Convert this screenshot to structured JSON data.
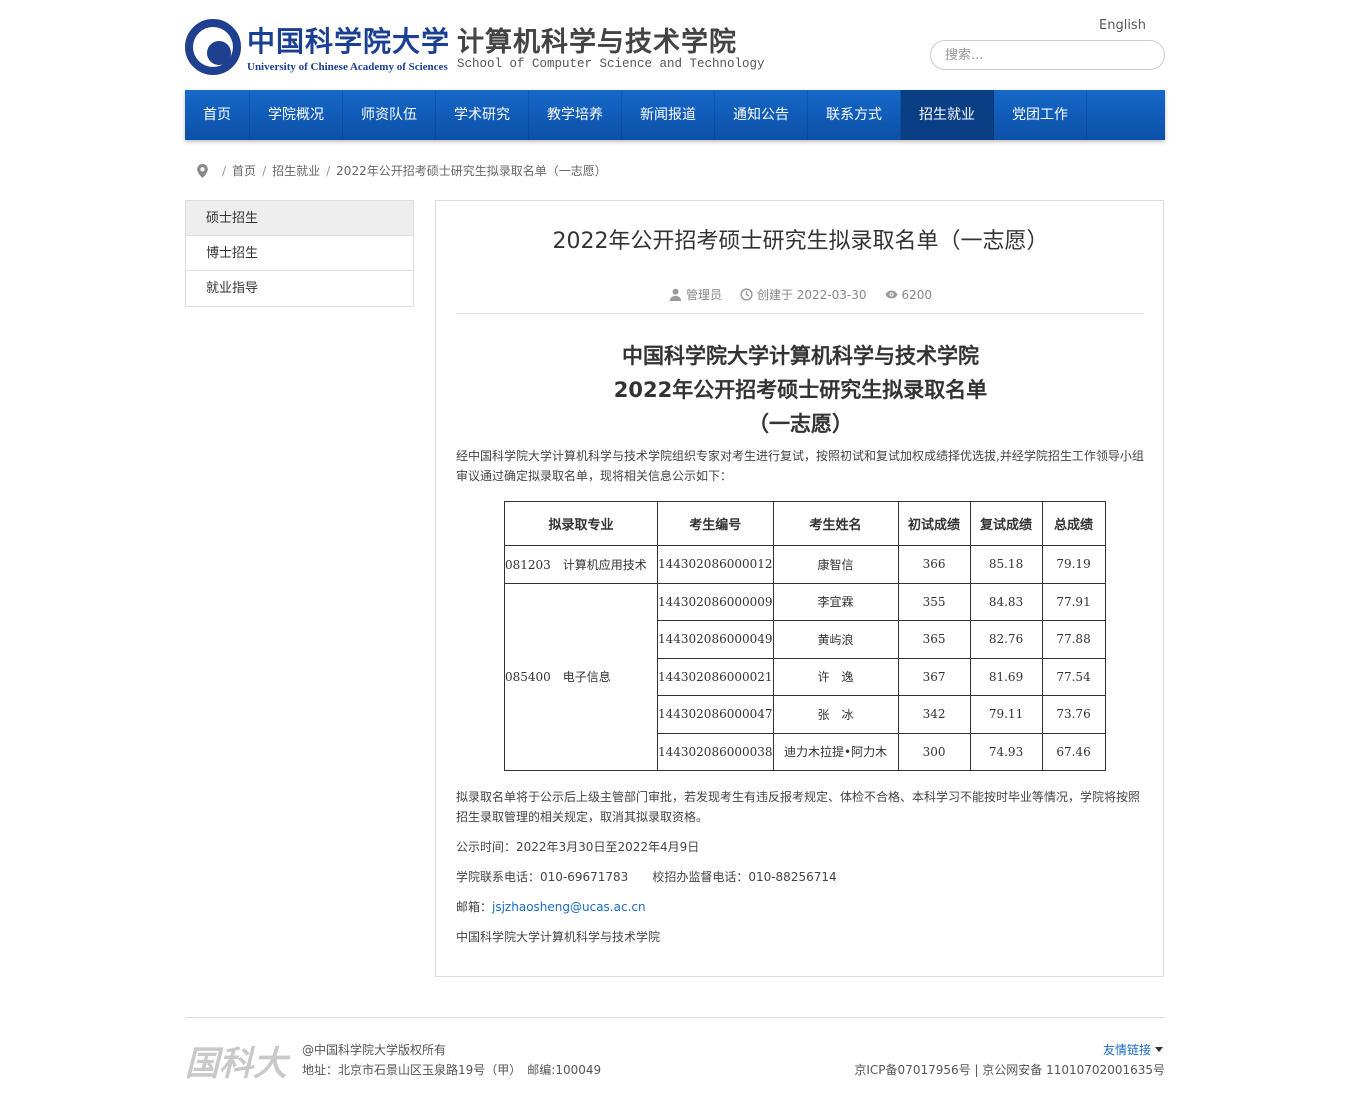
{
  "header": {
    "logo_cn": "中国科学院大学",
    "logo_en": "University of Chinese Academy of Sciences",
    "school_cn": "计算机科学与技术学院",
    "school_en": "School of Computer Science and Technology",
    "lang_link": "English",
    "search_placeholder": "搜索..."
  },
  "nav": {
    "items": [
      {
        "label": "首页"
      },
      {
        "label": "学院概况"
      },
      {
        "label": "师资队伍"
      },
      {
        "label": "学术研究"
      },
      {
        "label": "教学培养"
      },
      {
        "label": "新闻报道"
      },
      {
        "label": "通知公告"
      },
      {
        "label": "联系方式"
      },
      {
        "label": "招生就业"
      },
      {
        "label": "党团工作"
      }
    ],
    "active": "招生就业",
    "accent_color": "#0c50a8"
  },
  "breadcrumb": {
    "home": "首页",
    "section": "招生就业",
    "current": "2022年公开招考硕士研究生拟录取名单（一志愿）"
  },
  "sidebar": {
    "items": [
      {
        "label": "硕士招生"
      },
      {
        "label": "博士招生"
      },
      {
        "label": "就业指导"
      }
    ]
  },
  "article": {
    "title": "2022年公开招考硕士研究生拟录取名单（一志愿）",
    "author": "管理员",
    "created": "创建于 2022-03-30",
    "views": "6200",
    "doc_head": [
      "中国科学院大学计算机科学与技术学院",
      "2022年公开招考硕士研究生拟录取名单",
      "（一志愿）"
    ],
    "intro": "经中国科学院大学计算机科学与技术学院组织专家对考生进行复试，按照初试和复试加权成绩择优选拔,并经学院招生工作领导小组审议通过确定拟录取名单，现将相关信息公示如下：",
    "table": {
      "headers": [
        "拟录取专业",
        "考生编号",
        "考生姓名",
        "初试成绩",
        "复试成绩",
        "总成绩"
      ],
      "groups": [
        {
          "major": "081203　计算机应用技术",
          "rows": [
            [
              "144302086000012",
              "康智信",
              "366",
              "85.18",
              "79.19"
            ]
          ]
        },
        {
          "major": "085400　电子信息",
          "rows": [
            [
              "144302086000009",
              "李宜霖",
              "355",
              "84.83",
              "77.91"
            ],
            [
              "144302086000049",
              "黄屿浪",
              "365",
              "82.76",
              "77.88"
            ],
            [
              "144302086000021",
              "许　逸",
              "367",
              "81.69",
              "77.54"
            ],
            [
              "144302086000047",
              "张　冰",
              "342",
              "79.11",
              "73.76"
            ],
            [
              "144302086000038",
              "迪力木拉提•阿力木",
              "300",
              "74.93",
              "67.46"
            ]
          ]
        }
      ]
    },
    "note": "拟录取名单将于公示后上级主管部门审批，若发现考生有违反报考规定、体检不合格、本科学习不能按时毕业等情况，学院将按照招生录取管理的相关规定，取消其拟录取资格。",
    "period": "公示时间：2022年3月30日至2022年4月9日",
    "phone": "学院联系电话：010-69671783　　校招办监督电话：010-88256714",
    "email_label": "邮箱：",
    "email": "jsjzhaosheng@ucas.ac.cn",
    "signature": "中国科学院大学计算机科学与技术学院"
  },
  "footer": {
    "logo_text": "国科大",
    "copyright": "@中国科学院大学版权所有",
    "address": "地址：北京市石景山区玉泉路19号（甲）　邮编:100049",
    "friend_links": "友情链接",
    "icp": "京ICP备07017956号 | 京公网安备 11010702001635号"
  }
}
